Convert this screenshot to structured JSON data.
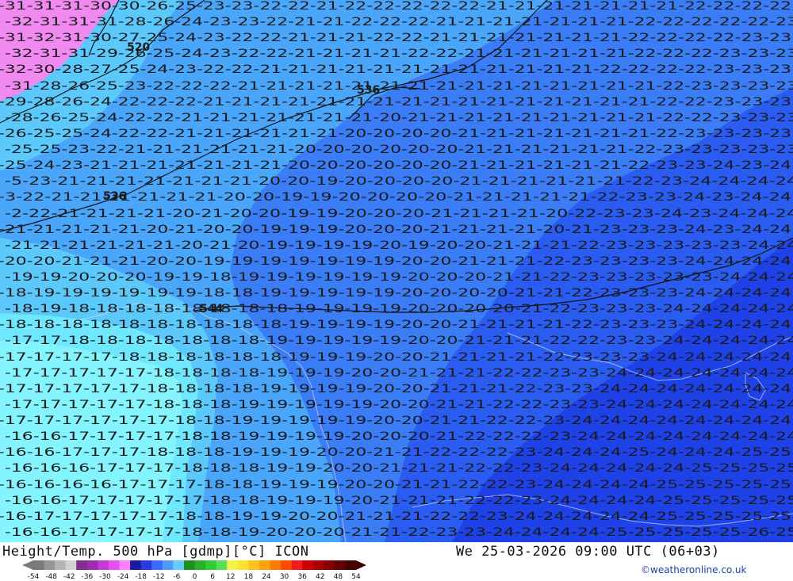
{
  "map": {
    "title": "Height/Temp. 500 hPa [gdmp][°C] ICON",
    "datetime": "We 25-03-2026 09:00 UTC (06+03)",
    "credit": "©weatheronline.co.uk",
    "geopotential_labels": [
      "520",
      "536",
      "536",
      "544"
    ],
    "temperature_label_rows": [
      "-31-31-31-30-30-26-25-23-23-22-22-21-22-22-22-22-22-21-21-21-21-21-21-21-22-22-22-22",
      "-32-31-31-31-28-26-24-23-23-22-21-21-22-22-22-21-21-21-21-21-21-21-22-22-22-22-22-23",
      "-31-32-31-30-27-25-24-23-22-22-21-21-21-22-22-21-21-21-21-21-21-21-22-22-22-22-23-23",
      "-32-31-31-29-26-25-24-23-22-22-21-21-21-21-22-22-21-21-21-21-21-21-22-22-22-23-23-23",
      "-32-30-28-27-25-24-23-22-22-21-21-21-21-21-21-21-21-21-21-21-21-22-22-22-22-23-23-23",
      "-31-28-26-25-23-22-22-22-21-21-21-21-21-21-21-21-21-21-21-21-21-21-21-22-23-23-23-23",
      "-29-28-26-24-22-22-22-21-21-21-21-21-21-21-21-21-21-21-21-21-21-21-21-22-22-23-23-23",
      "-28-26-25-24-22-22-21-21-21-21-21-21-21-20-21-21-21-21-21-21-21-21-21-22-22-23-23-23",
      "-26-25-25-24-22-22-21-21-21-21-21-21-20-20-20-20-21-21-21-21-21-21-21-22-23-23-23-23",
      "-25-25-23-22-21-21-21-21-21-21-20-20-20-20-20-20-21-21-21-21-21-21-22-23-23-23-23-23",
      "-25-24-23-21-21-21-21-21-21-21-20-20-20-20-20-20-21-21-21-21-21-21-22-23-23-24-23-24",
      "-5-23-21-21-21-21-21-21-21-20-20-19-20-20-20-20-21-21-21-21-21-21-22-23-24-24-24-24",
      "-3-22-21-21-21-21-21-21-20-20-19-19-20-20-20-20-21-21-21-21-21-22-23-23-24-23-24-24",
      "-2-22-21-21-21-21-20-21-20-20-19-19-20-20-20-21-21-21-21-20-22-23-23-24-23-24-24-24",
      "-21-21-21-21-21-20-21-20-20-19-19-19-20-20-20-21-21-21-21-20-21-23-23-23-24-23-24-24",
      "-21-21-21-21-21-21-20-21-20-19-19-19-19-20-19-20-20-21-21-21-22-23-23-23-23-23-24-24",
      "-20-20-21-21-21-20-20-19-19-19-19-19-19-19-20-20-21-21-21-22-23-23-23-23-24-24-24-24",
      "-19-19-20-20-20-19-19-18-19-19-19-19-19-19-20-20-20-21-21-22-23-23-23-23-23-24-24-24",
      "-18-19-19-19-19-19-19-18-18-19-19-19-19-19-20-20-20-20-21-21-22-23-23-23-24-24-24-24",
      "-18-19-18-18-18-18-18-18-18-18-19-19-19-19-20-20-20-20-21-22-23-23-23-24-24-24-24-24",
      "-18-18-18-18-18-18-18-18-18-18-19-19-19-19-20-20-21-21-21-21-22-23-23-23-24-24-24-24",
      "-17-17-18-18-18-18-18-18-18-19-19-19-19-19-20-20-21-21-21-22-22-23-23-24-24-24-24-24",
      "-17-17-17-17-18-18-18-18-18-18-19-19-19-20-20-21-21-21-21-22-23-23-23-24-24-24-24-24",
      "-17-17-17-17-17-18-18-18-18-19-19-19-20-20-21-21-21-22-22-23-23-24-24-24-24-24-24-24",
      "-17-17-17-17-17-18-18-18-18-19-19-19-19-20-20-21-21-21-22-23-23-24-24-24-24-24-24-24",
      "-17-17-17-17-17-18-18-18-19-19-19-19-19-20-20-21-21-22-22-23-23-24-24-24-24-24-24-24",
      "-17-17-17-17-17-17-18-18-19-19-19-19-19-20-20-21-21-22-22-23-24-24-24-24-24-24-24-24",
      "-16-16-17-17-17-17-18-18-19-19-19-19-20-20-20-21-22-22-22-23-24-24-24-24-24-24-24-24",
      "-16-16-17-17-17-18-18-18-19-19-19-20-20-21-21-22-22-22-23-24-24-24-25-24-24-24-25-25",
      "-16-16-16-17-17-17-18-18-18-19-19-20-20-21-21-21-22-22-23-24-24-24-24-24-25-25-25-25",
      "-16-16-16-16-17-17-17-18-18-19-19-19-20-20-21-21-22-22-23-24-24-24-24-25-25-25-25-25",
      "-16-16-17-17-17-17-17-18-18-19-19-19-20-21-21-21-22-22-23-24-24-24-24-25-25-25-25-25",
      "-16-17-17-17-17-17-18-18-19-19-20-20-21-21-21-22-22-23-24-24-24-24-24-25-25-25-25-25",
      "-16-16-17-17-17-17-18-18-19-20-20-20-21-21-22-23-23-24-24-24-24-25-25-25-25-25-26-25"
    ],
    "colorbar": {
      "ticks": [
        "-54",
        "-48",
        "-42",
        "-36",
        "-30",
        "-24",
        "-18",
        "-12",
        "-6",
        "0",
        "6",
        "12",
        "18",
        "24",
        "30",
        "36",
        "42",
        "48",
        "54"
      ],
      "colors": [
        "#7a7a7a",
        "#969696",
        "#b4b4b4",
        "#d2d2d2",
        "#7e2e8c",
        "#a12ab5",
        "#c43ad6",
        "#e64ff2",
        "#ff80ff",
        "#1a1aa0",
        "#2a3ae0",
        "#3a6aff",
        "#4f9aff",
        "#66ccff",
        "#1f8f1f",
        "#29b029",
        "#33cc33",
        "#55e055",
        "#f2f24a",
        "#ffe033",
        "#ffc21a",
        "#ffa10a",
        "#ff7a00",
        "#ff4a00",
        "#f21a1a",
        "#cc0000",
        "#aa0000",
        "#880000",
        "#660000",
        "#440000"
      ]
    },
    "field_colors": {
      "pink": "#f08af0",
      "dark_blue": "#1e42e8",
      "royal_blue": "#2a5cf2",
      "medium_blue": "#3a7df6",
      "sky_blue": "#4aa6fa",
      "light_blue": "#5cc9fc",
      "cyan": "#6ee8fe",
      "pale_cyan": "#84f5ff"
    }
  }
}
